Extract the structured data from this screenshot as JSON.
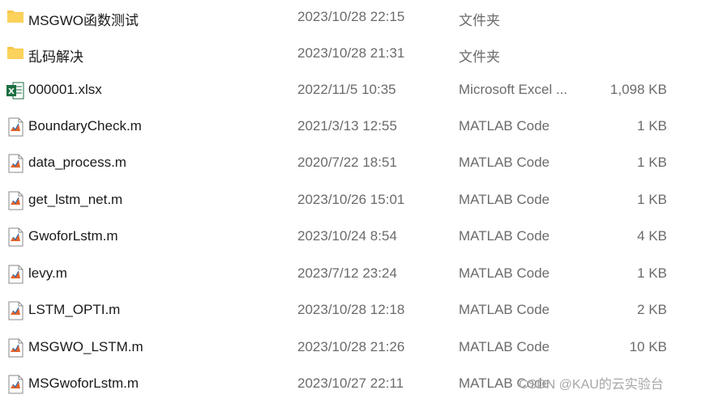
{
  "files": [
    {
      "name": "MSGWO函数测试",
      "date": "2023/10/28 22:15",
      "type": "文件夹",
      "size": "",
      "icon": "folder-icon"
    },
    {
      "name": "乱码解决",
      "date": "2023/10/28 21:31",
      "type": "文件夹",
      "size": "",
      "icon": "folder-icon"
    },
    {
      "name": "000001.xlsx",
      "date": "2022/11/5 10:35",
      "type": "Microsoft Excel ...",
      "size": "1,098 KB",
      "icon": "excel-file-icon"
    },
    {
      "name": "BoundaryCheck.m",
      "date": "2021/3/13 12:55",
      "type": "MATLAB Code",
      "size": "1 KB",
      "icon": "matlab-file-icon"
    },
    {
      "name": "data_process.m",
      "date": "2020/7/22 18:51",
      "type": "MATLAB Code",
      "size": "1 KB",
      "icon": "matlab-file-icon"
    },
    {
      "name": "get_lstm_net.m",
      "date": "2023/10/26 15:01",
      "type": "MATLAB Code",
      "size": "1 KB",
      "icon": "matlab-file-icon"
    },
    {
      "name": "GwoforLstm.m",
      "date": "2023/10/24 8:54",
      "type": "MATLAB Code",
      "size": "4 KB",
      "icon": "matlab-file-icon"
    },
    {
      "name": "levy.m",
      "date": "2023/7/12 23:24",
      "type": "MATLAB Code",
      "size": "1 KB",
      "icon": "matlab-file-icon"
    },
    {
      "name": "LSTM_OPTI.m",
      "date": "2023/10/28 12:18",
      "type": "MATLAB Code",
      "size": "2 KB",
      "icon": "matlab-file-icon"
    },
    {
      "name": "MSGWO_LSTM.m",
      "date": "2023/10/28 21:26",
      "type": "MATLAB Code",
      "size": "10 KB",
      "icon": "matlab-file-icon"
    },
    {
      "name": "MSGwoforLstm.m",
      "date": "2023/10/27 22:11",
      "type": "MATLAB Code",
      "size": "",
      "icon": "matlab-file-icon"
    }
  ],
  "watermark": "CSDN @KAU的云实验台",
  "colors": {
    "folder": "#f8c64a",
    "excel": "#1d6f42",
    "text": "#1a1a1a",
    "secondary_text": "#6b6b6b"
  }
}
